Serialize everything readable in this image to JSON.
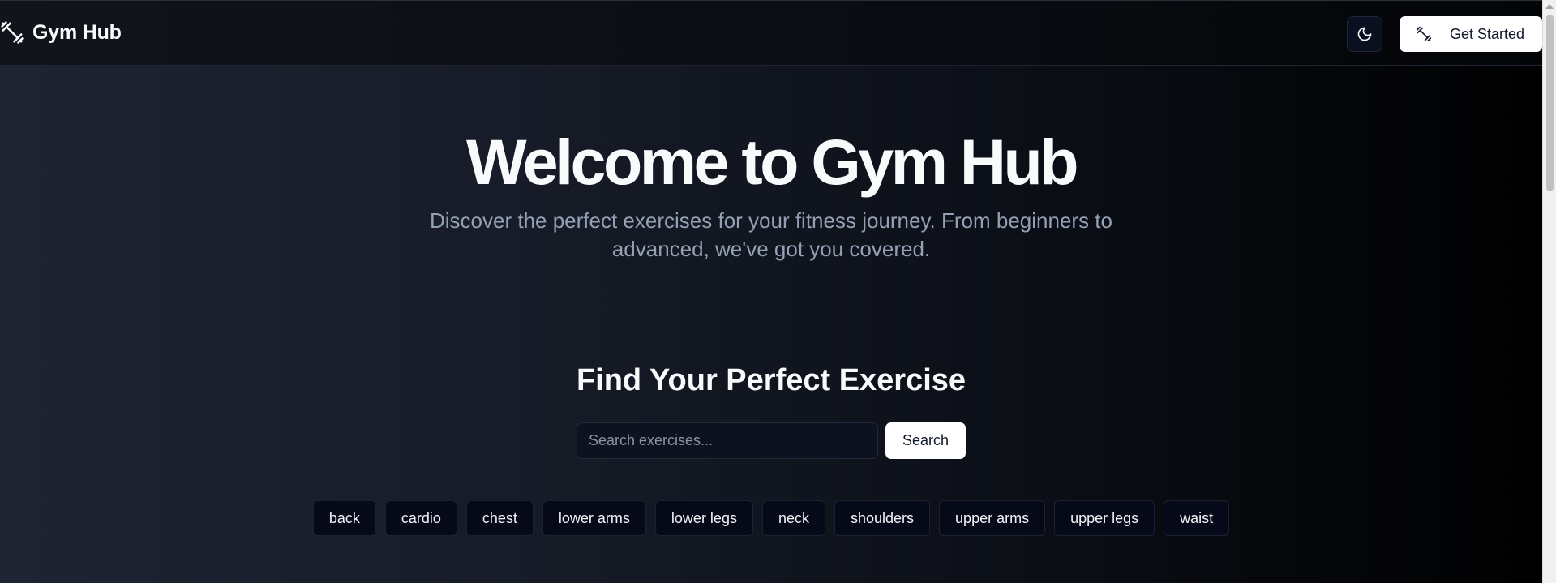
{
  "header": {
    "brand_name": "Gym Hub",
    "brand_icon": "dumbbell-icon",
    "theme_icon": "moon-icon",
    "cta_icon": "dumbbell-icon",
    "cta_label": "Get Started"
  },
  "hero": {
    "title": "Welcome to Gym Hub",
    "subtitle": "Discover the perfect exercises for your fitness journey. From beginners to advanced, we've got you covered."
  },
  "search": {
    "section_title": "Find Your Perfect Exercise",
    "placeholder": "Search exercises...",
    "value": "",
    "button_label": "Search"
  },
  "categories": [
    "back",
    "cardio",
    "chest",
    "lower arms",
    "lower legs",
    "neck",
    "shoulders",
    "upper arms",
    "upper legs",
    "waist"
  ],
  "colors": {
    "accent_button_bg": "#ffffff",
    "chip_bg": "#060a18",
    "subtitle_text": "#94a0b4"
  }
}
